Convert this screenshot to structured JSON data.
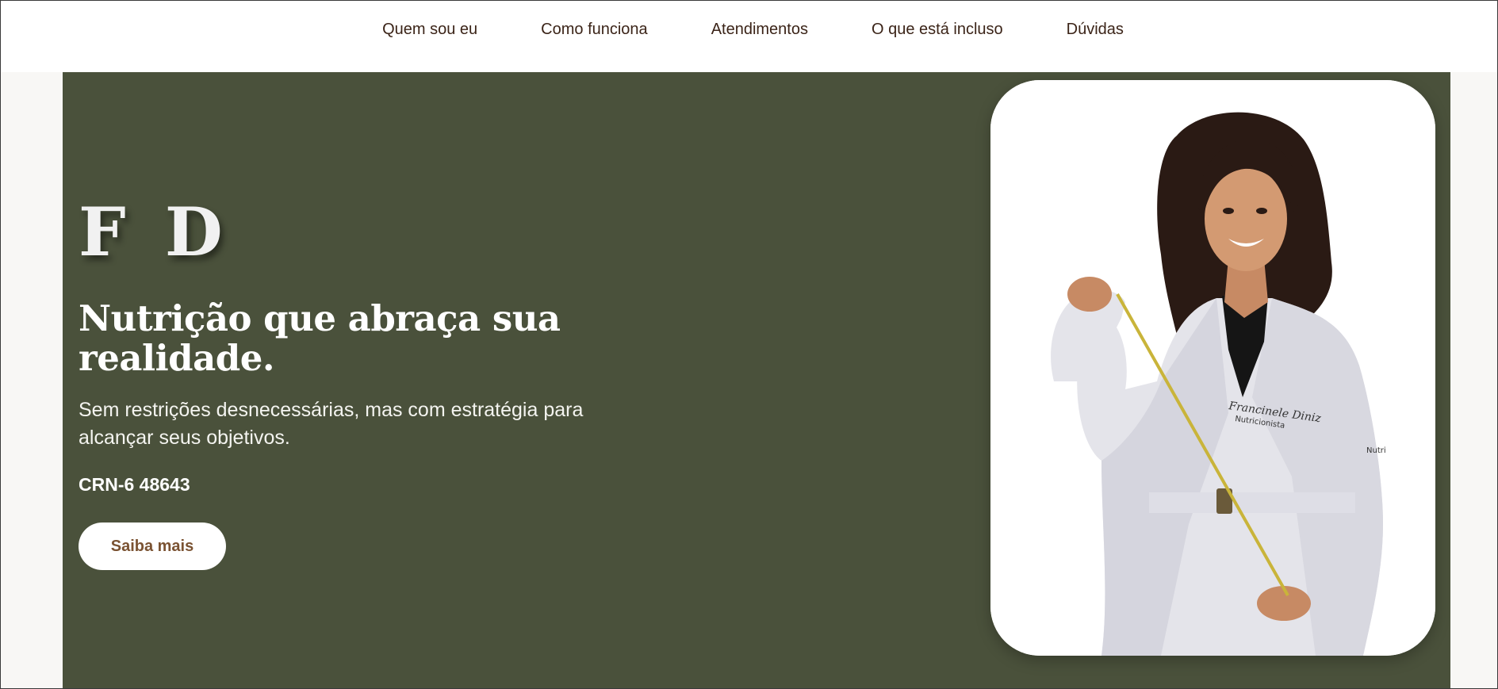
{
  "nav": {
    "items": [
      {
        "label": "Quem sou eu"
      },
      {
        "label": "Como funciona"
      },
      {
        "label": "Atendimentos"
      },
      {
        "label": "O que está incluso"
      },
      {
        "label": "Dúvidas"
      }
    ]
  },
  "hero": {
    "monogram": "F D",
    "headline": "Nutrição que abraça sua realidade.",
    "subtext": "Sem restrições desnecessárias, mas com estratégia para alcançar seus objetivos.",
    "crn": "CRN-6 48643",
    "cta_label": "Saiba mais"
  },
  "portrait": {
    "coat_name": "Francinele Diniz",
    "coat_title": "Nutricionista",
    "sleeve_text": "Nutri"
  },
  "colors": {
    "hero_bg": "#4a513b",
    "nav_text": "#3b2418",
    "cta_text": "#7a5232",
    "page_bg": "#f8f7f5"
  },
  "icons": [
    "measuring-tape-icon"
  ]
}
